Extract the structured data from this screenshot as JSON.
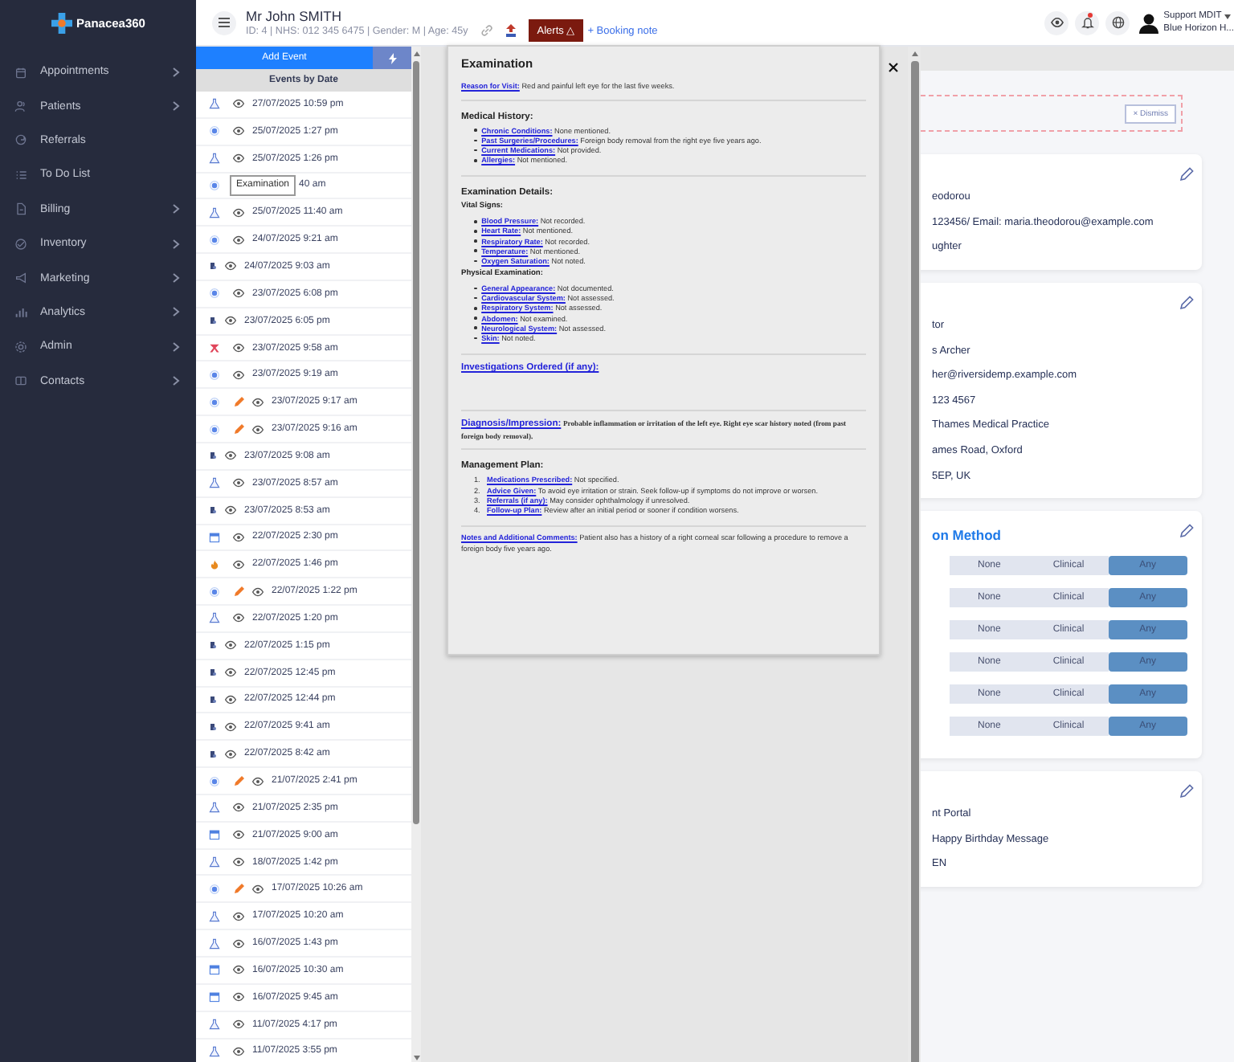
{
  "brand": {
    "name": "Panacea360"
  },
  "sidebar": {
    "items": [
      {
        "label": "Appointments",
        "expandable": true
      },
      {
        "label": "Patients",
        "expandable": true
      },
      {
        "label": "Referrals",
        "expandable": false
      },
      {
        "label": "To Do List",
        "expandable": false
      },
      {
        "label": "Billing",
        "expandable": true
      },
      {
        "label": "Inventory",
        "expandable": true
      },
      {
        "label": "Marketing",
        "expandable": true
      },
      {
        "label": "Analytics",
        "expandable": true
      },
      {
        "label": "Admin",
        "expandable": true
      },
      {
        "label": "Contacts",
        "expandable": true
      }
    ]
  },
  "patient": {
    "name": "Mr John SMITH",
    "details": "ID: 4 | NHS: 012 345 6475 | Gender: M | Age: 45y",
    "alerts": "Alerts △",
    "booking_note": "+ Booking note"
  },
  "user": {
    "name": "Support MDIT",
    "organisation": "Blue Horizon H..."
  },
  "notifications": {
    "unread": true
  },
  "events": {
    "add_label": "Add Event",
    "heading": "Events by Date",
    "rows": [
      {
        "kind": "exam",
        "editable": false,
        "date": "27/07/2025 10:59 pm"
      },
      {
        "kind": "eye",
        "editable": false,
        "date": "25/07/2025 1:27 pm"
      },
      {
        "kind": "exam",
        "editable": false,
        "date": "25/07/2025 1:26 pm"
      },
      {
        "kind": "eye",
        "editable": false,
        "date": "40 am",
        "tooltip": "Examination"
      },
      {
        "kind": "exam",
        "editable": false,
        "date": "25/07/2025 11:40 am"
      },
      {
        "kind": "eye",
        "editable": false,
        "date": "24/07/2025 9:21 am"
      },
      {
        "kind": "doc",
        "editable": false,
        "date": "24/07/2025 9:03 am"
      },
      {
        "kind": "eye",
        "editable": false,
        "date": "23/07/2025 6:08 pm"
      },
      {
        "kind": "doc",
        "editable": false,
        "date": "23/07/2025 6:05 pm"
      },
      {
        "kind": "ribbon",
        "editable": false,
        "date": "23/07/2025 9:58 am"
      },
      {
        "kind": "eye",
        "editable": false,
        "date": "23/07/2025 9:19 am"
      },
      {
        "kind": "eye",
        "editable": true,
        "date": "23/07/2025 9:17 am"
      },
      {
        "kind": "eye",
        "editable": true,
        "date": "23/07/2025 9:16 am"
      },
      {
        "kind": "doc",
        "editable": false,
        "date": "23/07/2025 9:08 am"
      },
      {
        "kind": "exam",
        "editable": false,
        "date": "23/07/2025 8:57 am"
      },
      {
        "kind": "doc",
        "editable": false,
        "date": "23/07/2025 8:53 am"
      },
      {
        "kind": "calendar",
        "editable": false,
        "date": "22/07/2025 2:30 pm"
      },
      {
        "kind": "flame",
        "editable": false,
        "date": "22/07/2025 1:46 pm"
      },
      {
        "kind": "eye",
        "editable": true,
        "date": "22/07/2025 1:22 pm"
      },
      {
        "kind": "exam",
        "editable": false,
        "date": "22/07/2025 1:20 pm"
      },
      {
        "kind": "doc",
        "editable": false,
        "date": "22/07/2025 1:15 pm"
      },
      {
        "kind": "doc",
        "editable": false,
        "date": "22/07/2025 12:45 pm"
      },
      {
        "kind": "doc",
        "editable": false,
        "date": "22/07/2025 12:44 pm"
      },
      {
        "kind": "doc",
        "editable": false,
        "date": "22/07/2025 9:41 am"
      },
      {
        "kind": "doc",
        "editable": false,
        "date": "22/07/2025 8:42 am"
      },
      {
        "kind": "eye",
        "editable": true,
        "date": "21/07/2025 2:41 pm"
      },
      {
        "kind": "exam",
        "editable": false,
        "date": "21/07/2025 2:35 pm"
      },
      {
        "kind": "calendar",
        "editable": false,
        "date": "21/07/2025 9:00 am"
      },
      {
        "kind": "exam",
        "editable": false,
        "date": "18/07/2025 1:42 pm"
      },
      {
        "kind": "eye",
        "editable": true,
        "date": "17/07/2025 10:26 am"
      },
      {
        "kind": "exam",
        "editable": false,
        "date": "17/07/2025 10:20 am"
      },
      {
        "kind": "exam",
        "editable": false,
        "date": "16/07/2025 1:43 pm"
      },
      {
        "kind": "calendar",
        "editable": false,
        "date": "16/07/2025 10:30 am"
      },
      {
        "kind": "calendar",
        "editable": false,
        "date": "16/07/2025 9:45 am"
      },
      {
        "kind": "exam",
        "editable": false,
        "date": "11/07/2025 4:17 pm"
      },
      {
        "kind": "exam",
        "editable": false,
        "date": "11/07/2025 3:55 pm"
      }
    ]
  },
  "modal": {
    "title": "Examination",
    "sections": [
      {
        "blocks": [
          {
            "kind": "field",
            "label": "Reason for Visit:",
            "text": "Red and painful left eye for the last five weeks."
          }
        ]
      },
      {
        "blocks": [
          {
            "kind": "heading",
            "text": "Medical History:"
          },
          {
            "kind": "bullets",
            "items": [
              {
                "label": "Chronic Conditions:",
                "text": "None mentioned."
              },
              {
                "label": "Past Surgeries/Procedures:",
                "text": "Foreign body removal from the right eye five years ago."
              },
              {
                "label": "Current Medications:",
                "text": "Not provided."
              },
              {
                "label": "Allergies:",
                "text": "Not mentioned."
              }
            ]
          }
        ]
      },
      {
        "blocks": [
          {
            "kind": "heading",
            "text": "Examination Details:"
          },
          {
            "kind": "subheading",
            "text": "Vital Signs:"
          },
          {
            "kind": "bullets",
            "items": [
              {
                "label": "Blood Pressure:",
                "text": "Not recorded."
              },
              {
                "label": "Heart Rate:",
                "text": "Not mentioned."
              },
              {
                "label": "Respiratory Rate:",
                "text": "Not recorded."
              },
              {
                "label": "Temperature:",
                "text": "Not mentioned."
              },
              {
                "label": "Oxygen Saturation:",
                "text": "Not noted."
              }
            ]
          },
          {
            "kind": "subheading",
            "text": "Physical Examination:"
          },
          {
            "kind": "bullets",
            "items": [
              {
                "label": "General Appearance:",
                "text": "Not documented."
              },
              {
                "label": "Cardiovascular System:",
                "text": "Not assessed."
              },
              {
                "label": "Respiratory System:",
                "text": "Not assessed."
              },
              {
                "label": "Abdomen:",
                "text": "Not examined."
              },
              {
                "label": "Neurological System:",
                "text": "Not assessed."
              },
              {
                "label": "Skin:",
                "text": "Not noted."
              }
            ]
          }
        ]
      },
      {
        "blocks": [
          {
            "kind": "field",
            "label": "Investigations Ordered (if any):"
          }
        ]
      },
      {
        "blocks": [
          {
            "kind": "finding",
            "label": "Diagnosis/Impression:",
            "text": "Probable inflammation or irritation of the left eye. Right eye scar history noted (from past foreign body removal)."
          }
        ]
      },
      {
        "blocks": [
          {
            "kind": "heading",
            "text": "Management Plan:"
          },
          {
            "kind": "numbered",
            "items": [
              {
                "number": "1.",
                "label": "Medications Prescribed:",
                "text": "Not specified."
              },
              {
                "number": "2.",
                "label": "Advice Given:",
                "text": "To avoid eye irritation or strain. Seek follow-up if symptoms do not improve or worsen."
              },
              {
                "number": "3.",
                "label": "Referrals (if any):",
                "text": "May consider ophthalmology if unresolved."
              },
              {
                "number": "4.",
                "label": "Follow-up Plan:",
                "text": "Review after an initial period or sooner if condition worsens."
              }
            ]
          }
        ]
      },
      {
        "blocks": [
          {
            "kind": "field",
            "label": "Notes and Additional Comments:",
            "text": "Patient also has a history of a right corneal scar following a procedure to remove a foreign body five years ago."
          }
        ]
      }
    ]
  },
  "banner": {
    "dismiss": "× Dismiss"
  },
  "cards": [
    {
      "lines": [
        "eodorou",
        "123456/ Email: maria.theodorou@example.com",
        "ughter"
      ]
    },
    {
      "lines": [
        "tor",
        "s Archer",
        "her@riversidemp.example.com",
        "123 4567",
        "Thames Medical Practice",
        "ames Road, Oxford",
        "5EP, UK"
      ]
    },
    {
      "title": "on Method",
      "choices": [
        {
          "options": [
            {
              "label": "None",
              "selected": false
            },
            {
              "label": "Clinical",
              "selected": false
            },
            {
              "label": "Any",
              "selected": true
            }
          ]
        },
        {
          "options": [
            {
              "label": "None",
              "selected": false
            },
            {
              "label": "Clinical",
              "selected": false
            },
            {
              "label": "Any",
              "selected": true
            }
          ]
        },
        {
          "options": [
            {
              "label": "None",
              "selected": false
            },
            {
              "label": "Clinical",
              "selected": false
            },
            {
              "label": "Any",
              "selected": true
            }
          ]
        },
        {
          "options": [
            {
              "label": "None",
              "selected": false
            },
            {
              "label": "Clinical",
              "selected": false
            },
            {
              "label": "Any",
              "selected": true
            }
          ]
        },
        {
          "options": [
            {
              "label": "None",
              "selected": false
            },
            {
              "label": "Clinical",
              "selected": false
            },
            {
              "label": "Any",
              "selected": true
            }
          ]
        },
        {
          "options": [
            {
              "label": "None",
              "selected": false
            },
            {
              "label": "Clinical",
              "selected": false
            },
            {
              "label": "Any",
              "selected": true
            }
          ]
        }
      ]
    },
    {
      "lines": [
        "nt Portal",
        "Happy Birthday Message",
        "EN"
      ]
    }
  ]
}
